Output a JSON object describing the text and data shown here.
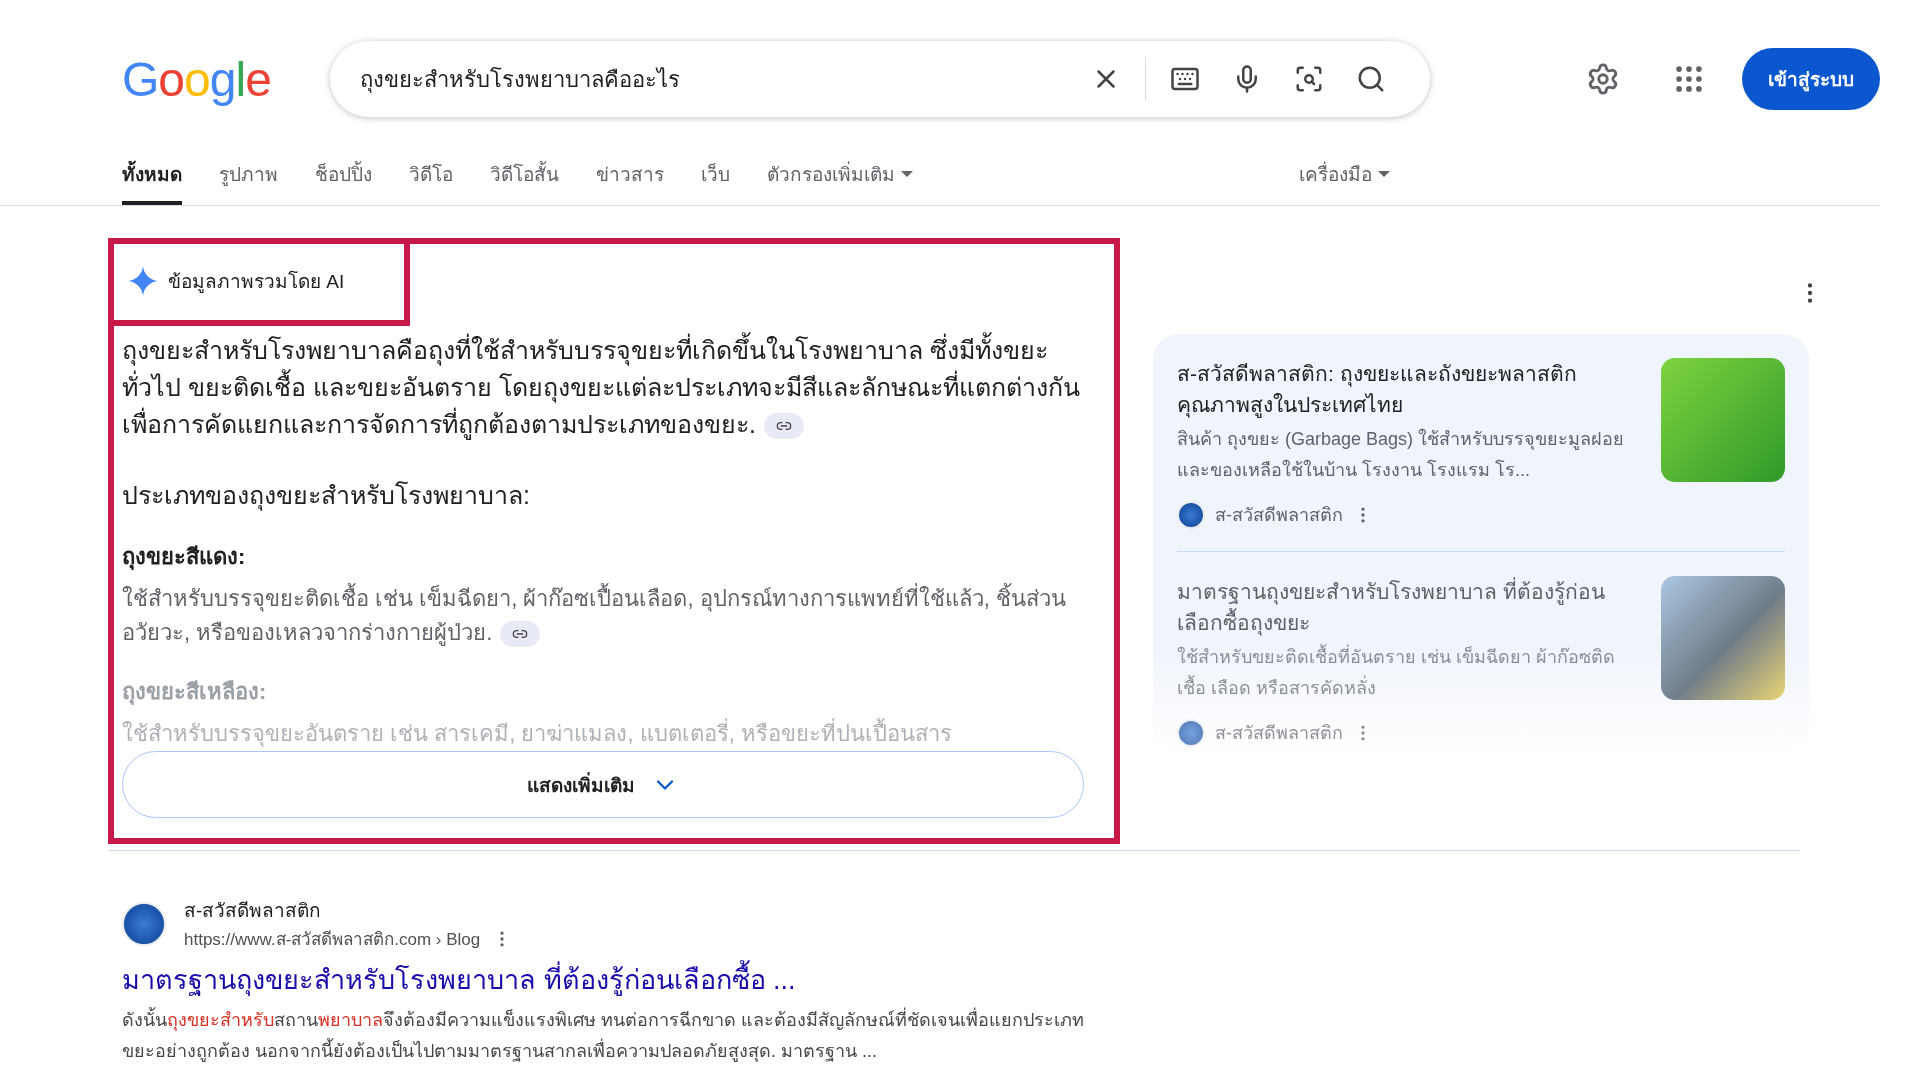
{
  "logo": "Google",
  "search": {
    "value": "ถุงขยะสำหรับโรงพยาบาลคืออะไร"
  },
  "sign_in": "เข้าสู่ระบบ",
  "tabs": [
    {
      "label": "ทั้งหมด",
      "selected": true,
      "dropdown": false
    },
    {
      "label": "รูปภาพ",
      "selected": false,
      "dropdown": false
    },
    {
      "label": "ช็อปปิ้ง",
      "selected": false,
      "dropdown": false
    },
    {
      "label": "วิดีโอ",
      "selected": false,
      "dropdown": false
    },
    {
      "label": "วิดีโอสั้น",
      "selected": false,
      "dropdown": false
    },
    {
      "label": "ข่าวสาร",
      "selected": false,
      "dropdown": false
    },
    {
      "label": "เว็บ",
      "selected": false,
      "dropdown": false
    },
    {
      "label": "ตัวกรองเพิ่มเติม",
      "selected": false,
      "dropdown": true
    }
  ],
  "tools": "เครื่องมือ",
  "ai_overview": {
    "title": "ข้อมูลภาพรวมโดย AI",
    "intro": "ถุงขยะสำหรับโรงพยาบาลคือถุงที่ใช้สำหรับบรรจุขยะที่เกิดขึ้นในโรงพยาบาล ซึ่งมีทั้งขยะทั่วไป ขยะติดเชื้อ และขยะอันตราย โดยถุงขยะแต่ละประเภทจะมีสีและลักษณะที่แตกต่างกันเพื่อการคัดแยกและการจัดการที่ถูกต้องตามประเภทของขยะ.",
    "heading": "ประเภทของถุงขยะสำหรับโรงพยาบาล:",
    "items": [
      {
        "title": "ถุงขยะสีแดง:",
        "text": "ใช้สำหรับบรรจุขยะติดเชื้อ เช่น เข็มฉีดยา, ผ้าก๊อซเปื้อนเลือด, อุปกรณ์ทางการแพทย์ที่ใช้แล้ว, ชิ้นส่วนอวัยวะ, หรือของเหลวจากร่างกายผู้ป่วย.",
        "faded": false
      },
      {
        "title": "ถุงขยะสีเหลือง:",
        "text": "ใช้สำหรับบรรจุขยะอันตราย เช่น สารเคมี, ยาฆ่าแมลง, แบตเตอรี่, หรือขยะที่ปนเปื้อนสาร",
        "faded": true
      }
    ],
    "show_more": "แสดงเพิ่มเติม"
  },
  "sources": [
    {
      "title": "ส-สวัสดีพลาสติก: ถุงขยะและถังขยะพลาสติกคุณภาพสูงในประเทศไทย",
      "snippet": "สินค้า ถุงขยะ (Garbage Bags) ใช้สำหรับบรรจุขยะมูลฝอยและของเหลือใช้ในบ้าน โรงงาน โรงแรม โร...",
      "site": "ส-สวัสดีพลาสติก",
      "faded": false
    },
    {
      "title": "มาตรฐานถุงขยะสำหรับโรงพยาบาล ที่ต้องรู้ก่อนเลือกซื้อถุงขยะ",
      "snippet": "ใช้สำหรับขยะติดเชื้อที่อันตราย เช่น เข็มฉีดยา ผ้าก๊อซติดเชื้อ เลือด หรือสารคัดหลั่ง",
      "site": "ส-สวัสดีพลาสติก",
      "faded": true
    }
  ],
  "result": {
    "site": "ส-สวัสดีพลาสติก",
    "url": "https://www.ส-สวัสดีพลาสติก.com › Blog",
    "title": "มาตรฐานถุงขยะสำหรับโรงพยาบาล ที่ต้องรู้ก่อนเลือกซื้อ ...",
    "snippet": [
      {
        "text": "ดังนั้น",
        "highlighted": false
      },
      {
        "text": "ถุงขยะสำหรับ",
        "highlighted": true
      },
      {
        "text": "สถาน",
        "highlighted": false
      },
      {
        "text": "พยาบาล",
        "highlighted": true
      },
      {
        "text": "จึงต้องมีความแข็งแรงพิเศษ ทนต่อการฉีกขาด และต้องมีสัญลักษณ์ที่ชัดเจนเพื่อแยกประเภทขยะอย่างถูกต้อง นอกจากนี้ยังต้องเป็นไปตามมาตรฐานสากลเพื่อความปลอดภัยสูงสุด. มาตรฐาน ...",
        "highlighted": false
      }
    ]
  }
}
